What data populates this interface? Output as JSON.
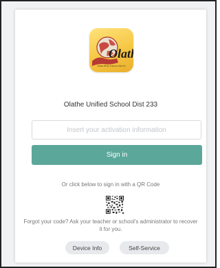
{
  "logo": {
    "wordmark": "Olathe",
    "subtitle": "Olathe Public Schools USD 233",
    "icon": "olathe-district-logo"
  },
  "org_name": "Olathe Unified School Dist 233",
  "activation": {
    "placeholder": "Insert your activation information",
    "value": ""
  },
  "signin": {
    "label": "Sign in"
  },
  "qr": {
    "hint": "Or click below to sign in with a QR Code",
    "icon": "qr-code-icon"
  },
  "forgot": {
    "text": "Forgot your code? Ask your teacher or school's administrator to recover it for you."
  },
  "footer": {
    "device_info_label": "Device Info",
    "self_service_label": "Self-Service"
  },
  "colors": {
    "accent": "#5ba79a",
    "pill_bg": "#e7e9ec",
    "logo_bg": "#f6c744"
  }
}
